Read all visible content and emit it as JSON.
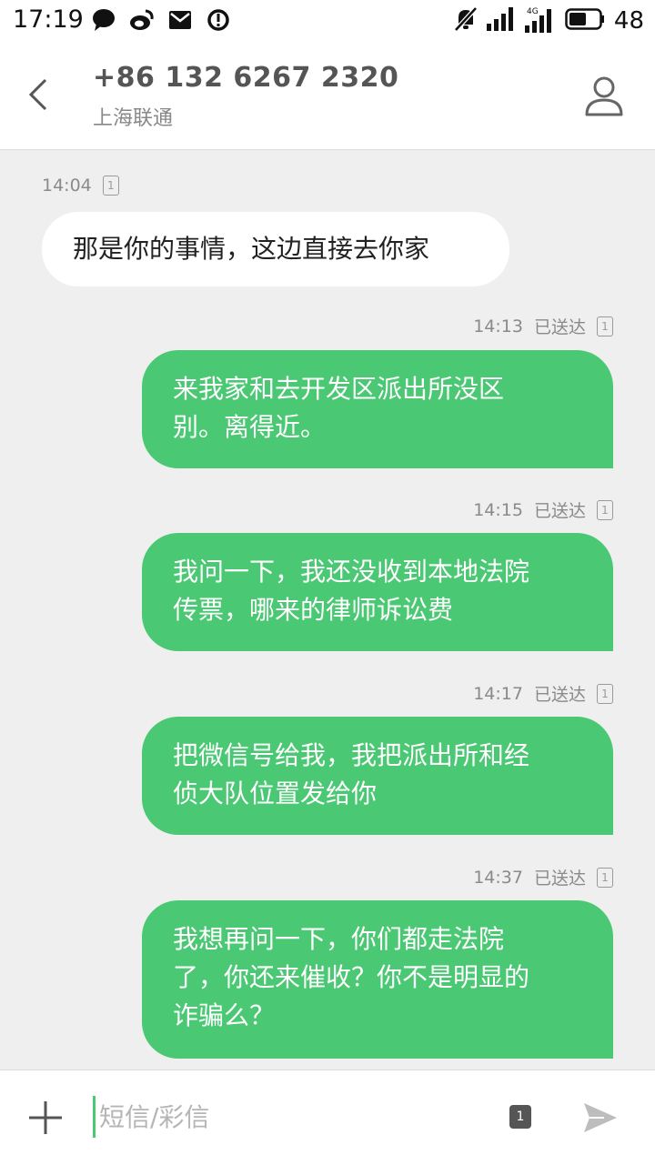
{
  "status_bar": {
    "time": "17:19",
    "battery": "48",
    "icons_left": [
      "chat-bubble-icon",
      "weibo-icon",
      "mail-icon",
      "sync-alert-icon"
    ],
    "icons_right": [
      "mute-icon",
      "signal-icon",
      "signal-4g-icon",
      "battery-icon"
    ],
    "network_label": "4G"
  },
  "header": {
    "contact_number": "+86 132 6267 2320",
    "carrier": "上海联通"
  },
  "messages": [
    {
      "direction": "incoming",
      "time": "14:04",
      "status": "",
      "sim": "1",
      "lines": [
        "那是你的事情，这边直接去你家"
      ]
    },
    {
      "direction": "outgoing",
      "time": "14:13",
      "status": "已送达",
      "sim": "1",
      "lines": [
        "来我家和去开发区派出所没区",
        "别。离得近。"
      ]
    },
    {
      "direction": "outgoing",
      "time": "14:15",
      "status": "已送达",
      "sim": "1",
      "lines": [
        "我问一下，我还没收到本地法院",
        "传票，哪来的律师诉讼费"
      ]
    },
    {
      "direction": "outgoing",
      "time": "14:17",
      "status": "已送达",
      "sim": "1",
      "lines": [
        "把微信号给我，我把派出所和经",
        "侦大队位置发给你"
      ]
    },
    {
      "direction": "outgoing",
      "time": "14:37",
      "status": "已送达",
      "sim": "1",
      "lines": [
        "我想再问一下，你们都走法院",
        "了，你还来催收？你不是明显的",
        "诈骗么？"
      ]
    }
  ],
  "input_bar": {
    "placeholder": "短信/彩信",
    "sim_label": "1"
  },
  "colors": {
    "accent": "#4bc873",
    "background": "#efefef",
    "incoming_bubble": "#ffffff",
    "outgoing_bubble": "#4bc873"
  }
}
